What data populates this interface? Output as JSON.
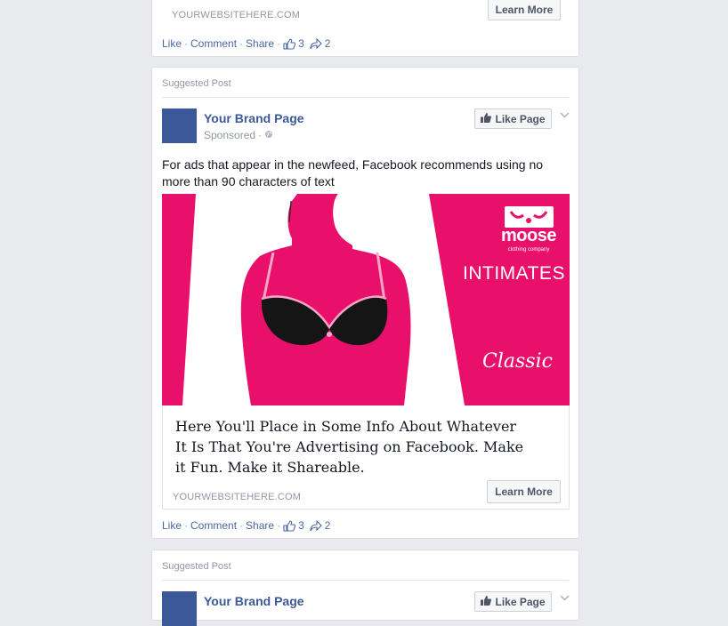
{
  "top_card": {
    "website": "YOURWEBSITEHERE.COM",
    "learn_more": "Learn More",
    "actions": {
      "like": "Like",
      "comment": "Comment",
      "share": "Share",
      "like_count": "3",
      "share_count": "2"
    }
  },
  "main_card": {
    "suggested": "Suggested Post",
    "brand": "Your Brand Page",
    "sponsored": "Sponsored",
    "like_page": "Like Page",
    "post_text": "For ads that appear in the newfeed, Facebook recommends using no more than 90 characters of text",
    "ad_image": {
      "logo_text": "moose",
      "logo_subtext": "clothing company",
      "category": "INTIMATES",
      "tagline": "Classic",
      "brand_color": "#e8106b"
    },
    "headline": "Here You'll Place in Some Info About Whatever It Is That You're Advertising on Facebook. Make it Fun. Make it Shareable.",
    "website": "YOURWEBSITEHERE.COM",
    "learn_more": "Learn More",
    "actions": {
      "like": "Like",
      "comment": "Comment",
      "share": "Share",
      "like_count": "3",
      "share_count": "2"
    }
  },
  "bottom_card": {
    "suggested": "Suggested Post",
    "brand": "Your Brand Page",
    "like_page": "Like Page"
  },
  "colors": {
    "fb_blue": "#3b5998",
    "link": "#4b67a1",
    "muted": "#9197a3",
    "page_bg": "#e9eaed"
  }
}
